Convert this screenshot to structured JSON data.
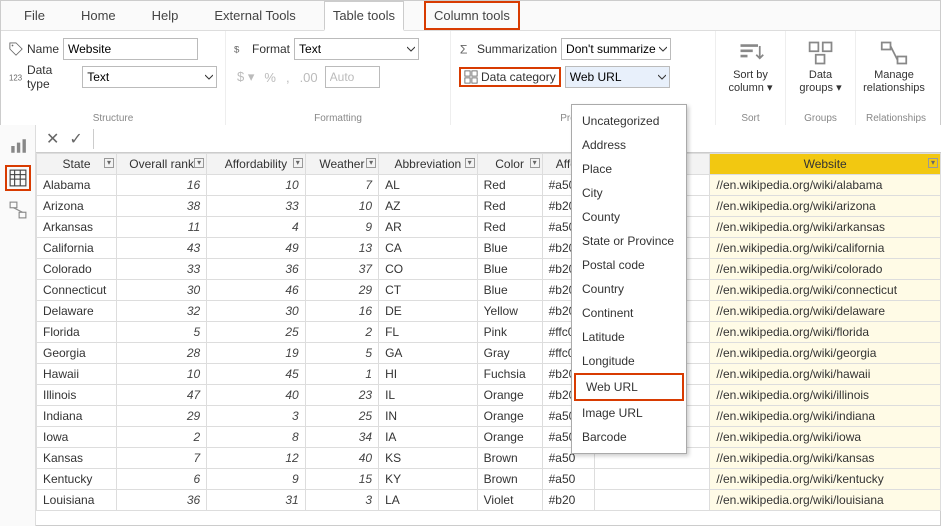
{
  "tabs": [
    "File",
    "Home",
    "Help",
    "External Tools",
    "Table tools",
    "Column tools"
  ],
  "ribbon": {
    "name_label": "Name",
    "name_value": "Website",
    "datatype_label": "Data type",
    "datatype_value": "Text",
    "format_label": "Format",
    "format_value": "Text",
    "auto_label": "Auto",
    "summ_label": "Summarization",
    "summ_value": "Don't summarize",
    "datacat_label": "Data category",
    "datacat_value": "Web URL",
    "sortby": "Sort by\ncolumn",
    "datagroups": "Data\ngroups",
    "manage_rel": "Manage\nrelationships",
    "grp_structure": "Structure",
    "grp_formatting": "Formatting",
    "grp_properties": "Properties",
    "grp_sort": "Sort",
    "grp_groups": "Groups",
    "grp_rel": "Relationships"
  },
  "dropdown_items": [
    "Uncategorized",
    "Address",
    "Place",
    "City",
    "County",
    "State or Province",
    "Postal code",
    "Country",
    "Continent",
    "Latitude",
    "Longitude",
    "Web URL",
    "Image URL",
    "Barcode"
  ],
  "columns": [
    "State",
    "Overall rank",
    "Affordability",
    "Weather",
    "Abbreviation",
    "Color",
    "Affor",
    "",
    "Website"
  ],
  "rows": [
    {
      "state": "Alabama",
      "rank": 16,
      "aff": 10,
      "weather": 7,
      "abbr": "AL",
      "color": "Red",
      "hex": "#a50",
      "url": "//en.wikipedia.org/wiki/alabama"
    },
    {
      "state": "Arizona",
      "rank": 38,
      "aff": 33,
      "weather": 10,
      "abbr": "AZ",
      "color": "Red",
      "hex": "#b20",
      "url": "//en.wikipedia.org/wiki/arizona"
    },
    {
      "state": "Arkansas",
      "rank": 11,
      "aff": 4,
      "weather": 9,
      "abbr": "AR",
      "color": "Red",
      "hex": "#a50",
      "url": "//en.wikipedia.org/wiki/arkansas"
    },
    {
      "state": "California",
      "rank": 43,
      "aff": 49,
      "weather": 13,
      "abbr": "CA",
      "color": "Blue",
      "hex": "#b20",
      "url": "//en.wikipedia.org/wiki/california"
    },
    {
      "state": "Colorado",
      "rank": 33,
      "aff": 36,
      "weather": 37,
      "abbr": "CO",
      "color": "Blue",
      "hex": "#b20",
      "url": "//en.wikipedia.org/wiki/colorado"
    },
    {
      "state": "Connecticut",
      "rank": 30,
      "aff": 46,
      "weather": 29,
      "abbr": "CT",
      "color": "Blue",
      "hex": "#b20",
      "url": "//en.wikipedia.org/wiki/connecticut"
    },
    {
      "state": "Delaware",
      "rank": 32,
      "aff": 30,
      "weather": 16,
      "abbr": "DE",
      "color": "Yellow",
      "hex": "#b20",
      "url": "//en.wikipedia.org/wiki/delaware"
    },
    {
      "state": "Florida",
      "rank": 5,
      "aff": 25,
      "weather": 2,
      "abbr": "FL",
      "color": "Pink",
      "hex": "#ffc0",
      "url": "//en.wikipedia.org/wiki/florida"
    },
    {
      "state": "Georgia",
      "rank": 28,
      "aff": 19,
      "weather": 5,
      "abbr": "GA",
      "color": "Gray",
      "hex": "#ffc0",
      "url": "//en.wikipedia.org/wiki/georgia"
    },
    {
      "state": "Hawaii",
      "rank": 10,
      "aff": 45,
      "weather": 1,
      "abbr": "HI",
      "color": "Fuchsia",
      "hex": "#b20",
      "url": "//en.wikipedia.org/wiki/hawaii"
    },
    {
      "state": "Illinois",
      "rank": 47,
      "aff": 40,
      "weather": 23,
      "abbr": "IL",
      "color": "Orange",
      "hex": "#b20",
      "url": "//en.wikipedia.org/wiki/illinois"
    },
    {
      "state": "Indiana",
      "rank": 29,
      "aff": 3,
      "weather": 25,
      "abbr": "IN",
      "color": "Orange",
      "hex": "#a50",
      "url": "//en.wikipedia.org/wiki/indiana"
    },
    {
      "state": "Iowa",
      "rank": 2,
      "aff": 8,
      "weather": 34,
      "abbr": "IA",
      "color": "Orange",
      "hex": "#a50",
      "url": "//en.wikipedia.org/wiki/iowa"
    },
    {
      "state": "Kansas",
      "rank": 7,
      "aff": 12,
      "weather": 40,
      "abbr": "KS",
      "color": "Brown",
      "hex": "#a50",
      "url": "//en.wikipedia.org/wiki/kansas"
    },
    {
      "state": "Kentucky",
      "rank": 6,
      "aff": 9,
      "weather": 15,
      "abbr": "KY",
      "color": "Brown",
      "hex": "#a50",
      "url": "//en.wikipedia.org/wiki/kentucky"
    },
    {
      "state": "Louisiana",
      "rank": 36,
      "aff": 31,
      "weather": 3,
      "abbr": "LA",
      "color": "Violet",
      "hex": "#b20",
      "url": "//en.wikipedia.org/wiki/louisiana"
    }
  ]
}
